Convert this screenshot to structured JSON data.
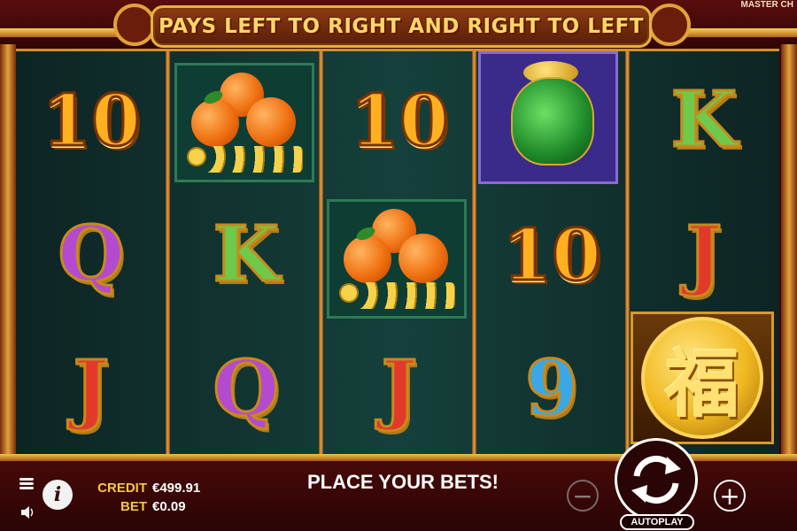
{
  "banner": {
    "text": "PAYS LEFT TO RIGHT AND RIGHT TO LEFT"
  },
  "brand": {
    "text": "MASTER CH"
  },
  "reels": [
    {
      "symbols": [
        "10",
        "Q",
        "J"
      ]
    },
    {
      "symbols": [
        "oranges",
        "K",
        "Q"
      ]
    },
    {
      "symbols": [
        "10",
        "oranges",
        "J"
      ]
    },
    {
      "symbols": [
        "vase",
        "10",
        "9"
      ]
    },
    {
      "symbols": [
        "K",
        "J",
        "福"
      ]
    }
  ],
  "hud": {
    "credit_label": "CREDIT",
    "credit_value": "€499.91",
    "bet_label": "BET",
    "bet_value": "€0.09",
    "status": "PLACE YOUR BETS!",
    "autoplay_label": "AUTOPLAY",
    "minus": "−",
    "plus": "+",
    "info": "i"
  },
  "colors": {
    "frame_gold": "#e7b045",
    "reel_bg": "#15403b",
    "label_gold": "#f5c744"
  }
}
